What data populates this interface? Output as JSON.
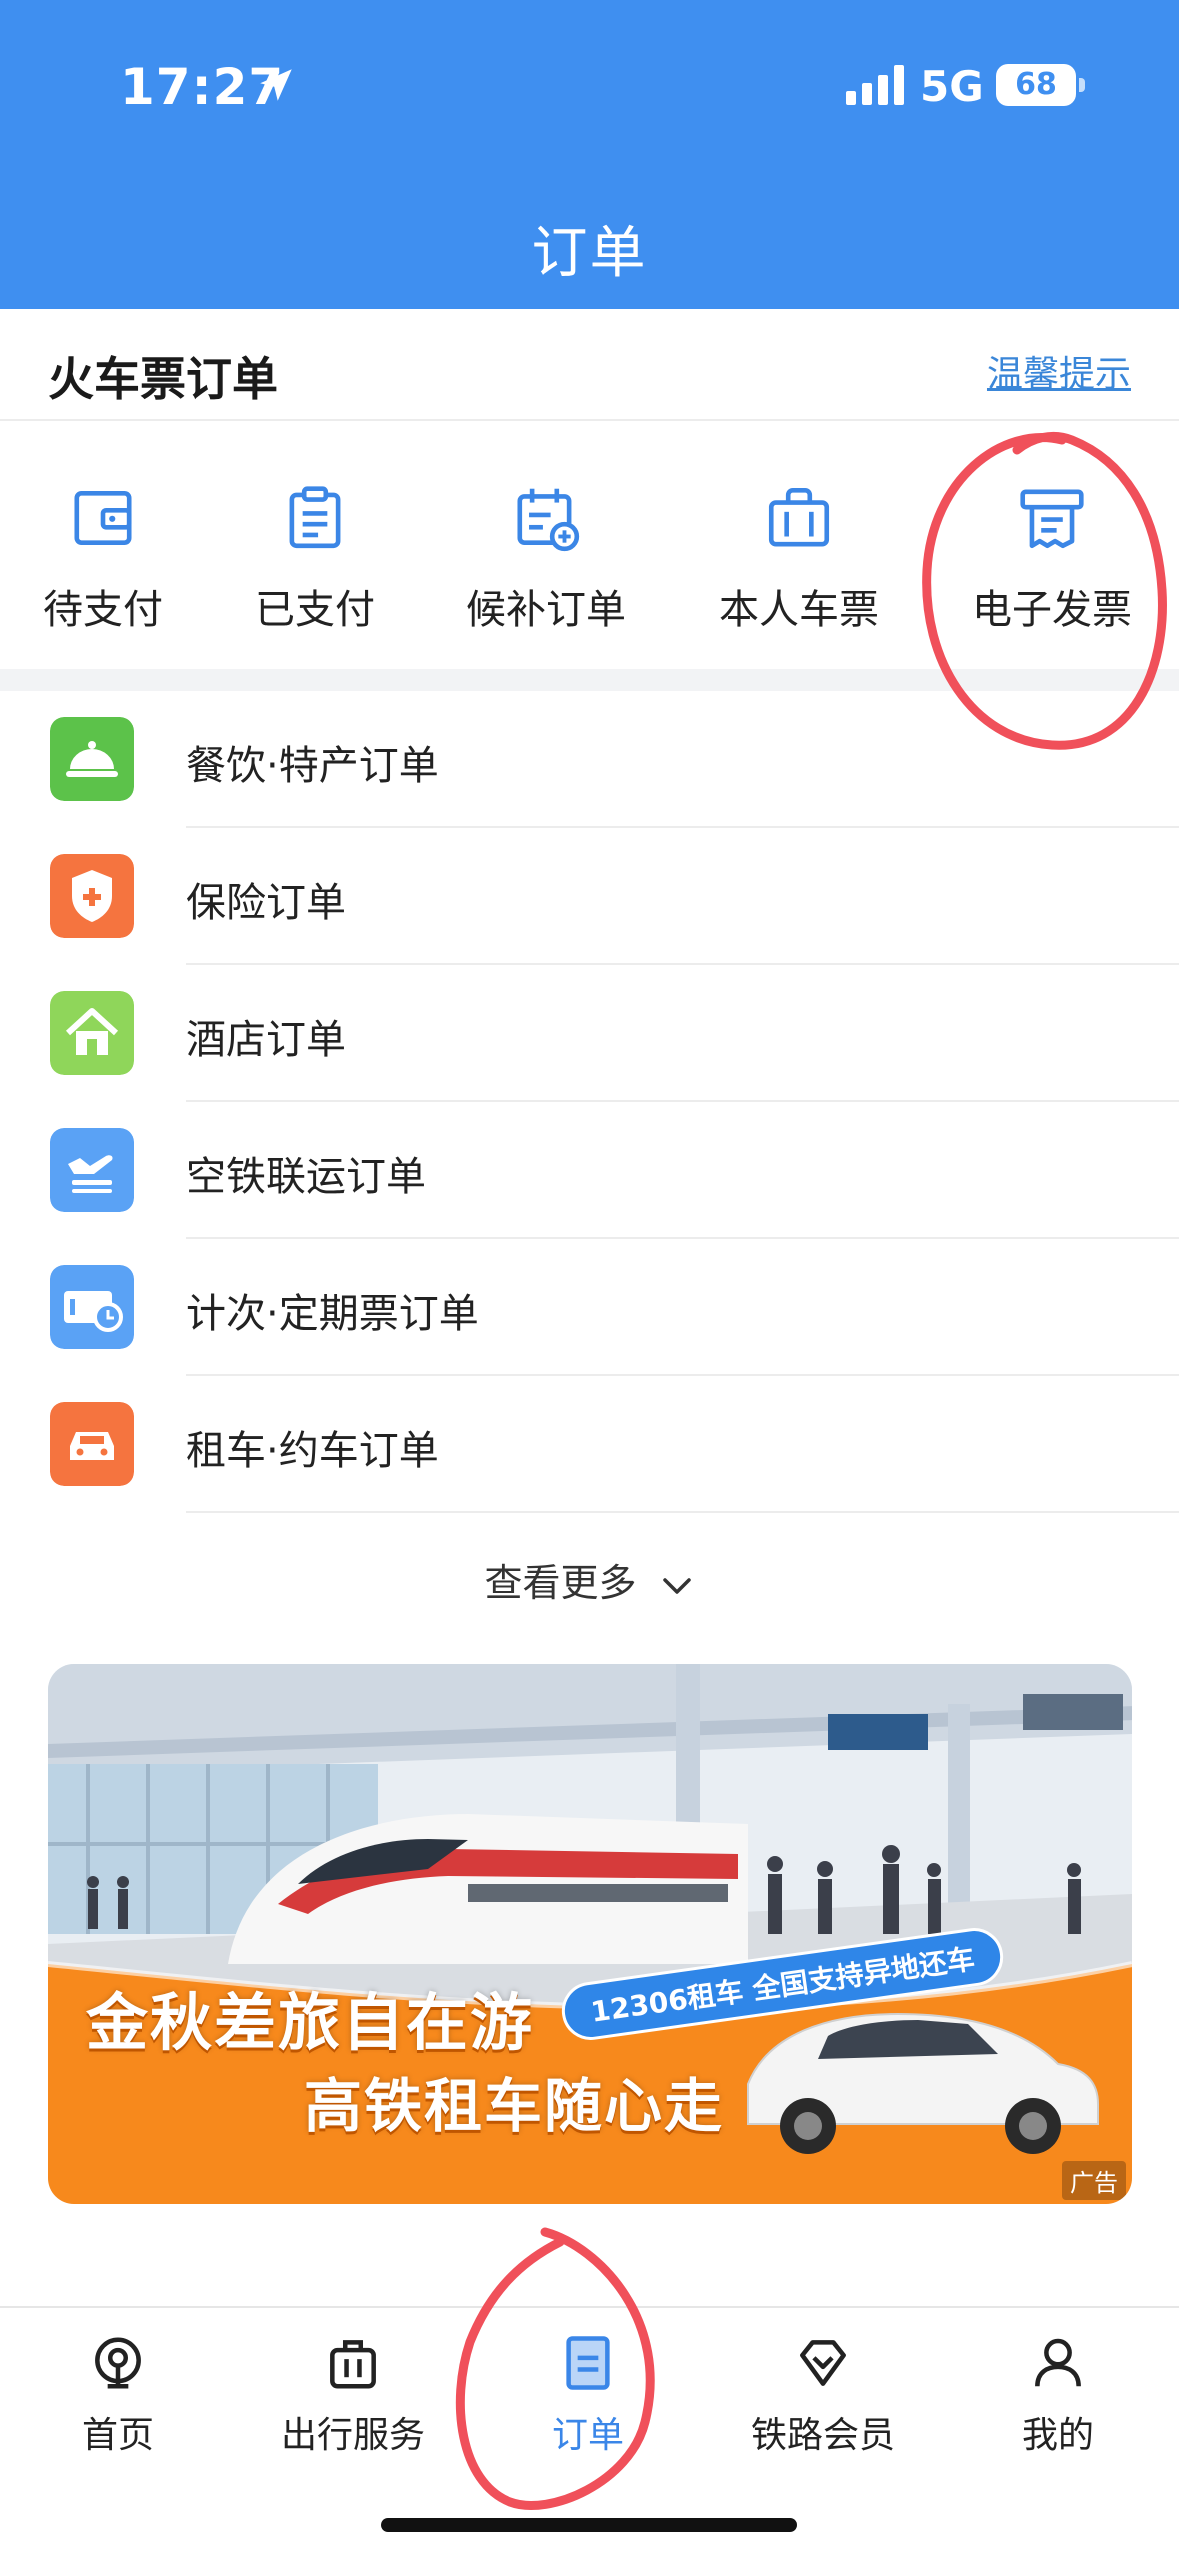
{
  "status_bar": {
    "time": "17:27",
    "network": "5G",
    "battery": "68"
  },
  "header": {
    "title": "订单"
  },
  "train_orders": {
    "title": "火车票订单",
    "tips_link": "温馨提示",
    "quick_actions": [
      {
        "label": "待支付",
        "icon": "wallet-icon"
      },
      {
        "label": "已支付",
        "icon": "clipboard-icon"
      },
      {
        "label": "候补订单",
        "icon": "calendar-add-icon"
      },
      {
        "label": "本人车票",
        "icon": "luggage-icon"
      },
      {
        "label": "电子发票",
        "icon": "invoice-printer-icon"
      }
    ]
  },
  "order_list": [
    {
      "label": "餐饮·特产订单",
      "icon": "food-cloche-icon",
      "color": "#5cc24a"
    },
    {
      "label": "保险订单",
      "icon": "shield-plus-icon",
      "color": "#f5743f"
    },
    {
      "label": "酒店订单",
      "icon": "house-icon",
      "color": "#8fd65a"
    },
    {
      "label": "空铁联运订单",
      "icon": "plane-train-icon",
      "color": "#4d9af5"
    },
    {
      "label": "计次·定期票订单",
      "icon": "ticket-clock-icon",
      "color": "#4d9af5"
    },
    {
      "label": "租车·约车订单",
      "icon": "car-icon",
      "color": "#f5743f"
    }
  ],
  "more": {
    "label": "查看更多"
  },
  "banner": {
    "headline1": "金秋差旅自在游",
    "headline2": "高铁租车随心走",
    "pill": "12306租车 全国支持异地还车",
    "ad_tag": "广告"
  },
  "tabbar": {
    "tabs": [
      {
        "label": "首页",
        "icon": "home-train-icon"
      },
      {
        "label": "出行服务",
        "icon": "suitcase-icon"
      },
      {
        "label": "订单",
        "icon": "order-doc-icon",
        "active": true
      },
      {
        "label": "铁路会员",
        "icon": "diamond-icon"
      },
      {
        "label": "我的",
        "icon": "person-icon"
      }
    ]
  },
  "colors": {
    "brand": "#3f8ff0",
    "active_tab": "#3a86e8",
    "annotation": "#f0505a"
  }
}
